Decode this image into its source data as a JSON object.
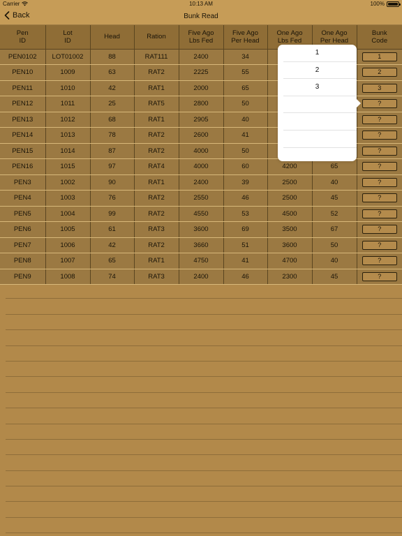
{
  "status": {
    "carrier": "Carrier",
    "time": "10:13 AM",
    "battery": "100%"
  },
  "nav": {
    "back_label": "Back",
    "title": "Bunk Read"
  },
  "table": {
    "headers": [
      [
        "Pen",
        "ID"
      ],
      [
        "Lot",
        "ID"
      ],
      [
        "Head",
        ""
      ],
      [
        "Ration",
        ""
      ],
      [
        "Five Ago",
        "Lbs Fed"
      ],
      [
        "Five Ago",
        "Per Head"
      ],
      [
        "One Ago",
        "Lbs Fed"
      ],
      [
        "One Ago",
        "Per Head"
      ],
      [
        "Bunk",
        "Code"
      ]
    ],
    "rows": [
      [
        "PEN0102",
        "LOT01002",
        "88",
        "RAT111",
        "2400",
        "34",
        "",
        "",
        "1"
      ],
      [
        "PEN10",
        "1009",
        "63",
        "RAT2",
        "2225",
        "55",
        "",
        "",
        "2"
      ],
      [
        "PEN11",
        "1010",
        "42",
        "RAT1",
        "2000",
        "65",
        "",
        "",
        "3"
      ],
      [
        "PEN12",
        "1011",
        "25",
        "RAT5",
        "2800",
        "50",
        "",
        "",
        "?"
      ],
      [
        "PEN13",
        "1012",
        "68",
        "RAT1",
        "2905",
        "40",
        "",
        "",
        "?"
      ],
      [
        "PEN14",
        "1013",
        "78",
        "RAT2",
        "2600",
        "41",
        "",
        "",
        "?"
      ],
      [
        "PEN15",
        "1014",
        "87",
        "RAT2",
        "4000",
        "50",
        "",
        "",
        "?"
      ],
      [
        "PEN16",
        "1015",
        "97",
        "RAT4",
        "4000",
        "60",
        "4200",
        "65",
        "?"
      ],
      [
        "PEN3",
        "1002",
        "90",
        "RAT1",
        "2400",
        "39",
        "2500",
        "40",
        "?"
      ],
      [
        "PEN4",
        "1003",
        "76",
        "RAT2",
        "2550",
        "46",
        "2500",
        "45",
        "?"
      ],
      [
        "PEN5",
        "1004",
        "99",
        "RAT2",
        "4550",
        "53",
        "4500",
        "52",
        "?"
      ],
      [
        "PEN6",
        "1005",
        "61",
        "RAT3",
        "3600",
        "69",
        "3500",
        "67",
        "?"
      ],
      [
        "PEN7",
        "1006",
        "42",
        "RAT2",
        "3660",
        "51",
        "3600",
        "50",
        "?"
      ],
      [
        "PEN8",
        "1007",
        "65",
        "RAT1",
        "4750",
        "41",
        "4700",
        "40",
        "?"
      ],
      [
        "PEN9",
        "1008",
        "74",
        "RAT3",
        "2400",
        "46",
        "2300",
        "45",
        "?"
      ]
    ]
  },
  "popover": {
    "options": [
      "1",
      "2",
      "3",
      "",
      "",
      "",
      ""
    ]
  },
  "colors": {
    "background": "#b2894a",
    "header": "#8f6d36",
    "cell": "#9b7942",
    "navbar": "#c69c57"
  }
}
